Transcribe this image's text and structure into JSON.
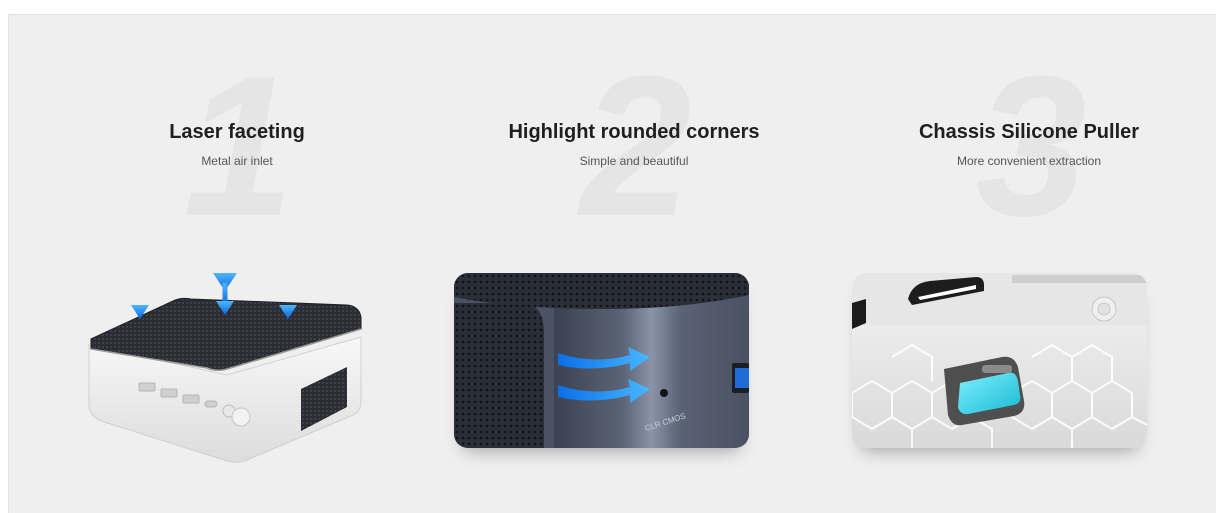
{
  "features": [
    {
      "number": "1",
      "title": "Laser faceting",
      "subtitle": "Metal air inlet"
    },
    {
      "number": "2",
      "title": "Highlight rounded corners",
      "subtitle": "Simple and beautiful"
    },
    {
      "number": "3",
      "title": "Chassis Silicone Puller",
      "subtitle": "More convenient extraction"
    }
  ],
  "image_labels": {
    "clr_cmos": "CLR CMOS"
  },
  "colors": {
    "panel_background": "#efefef",
    "accent_blue": "#1e90ff",
    "puller_cyan": "#3fd6e6"
  }
}
